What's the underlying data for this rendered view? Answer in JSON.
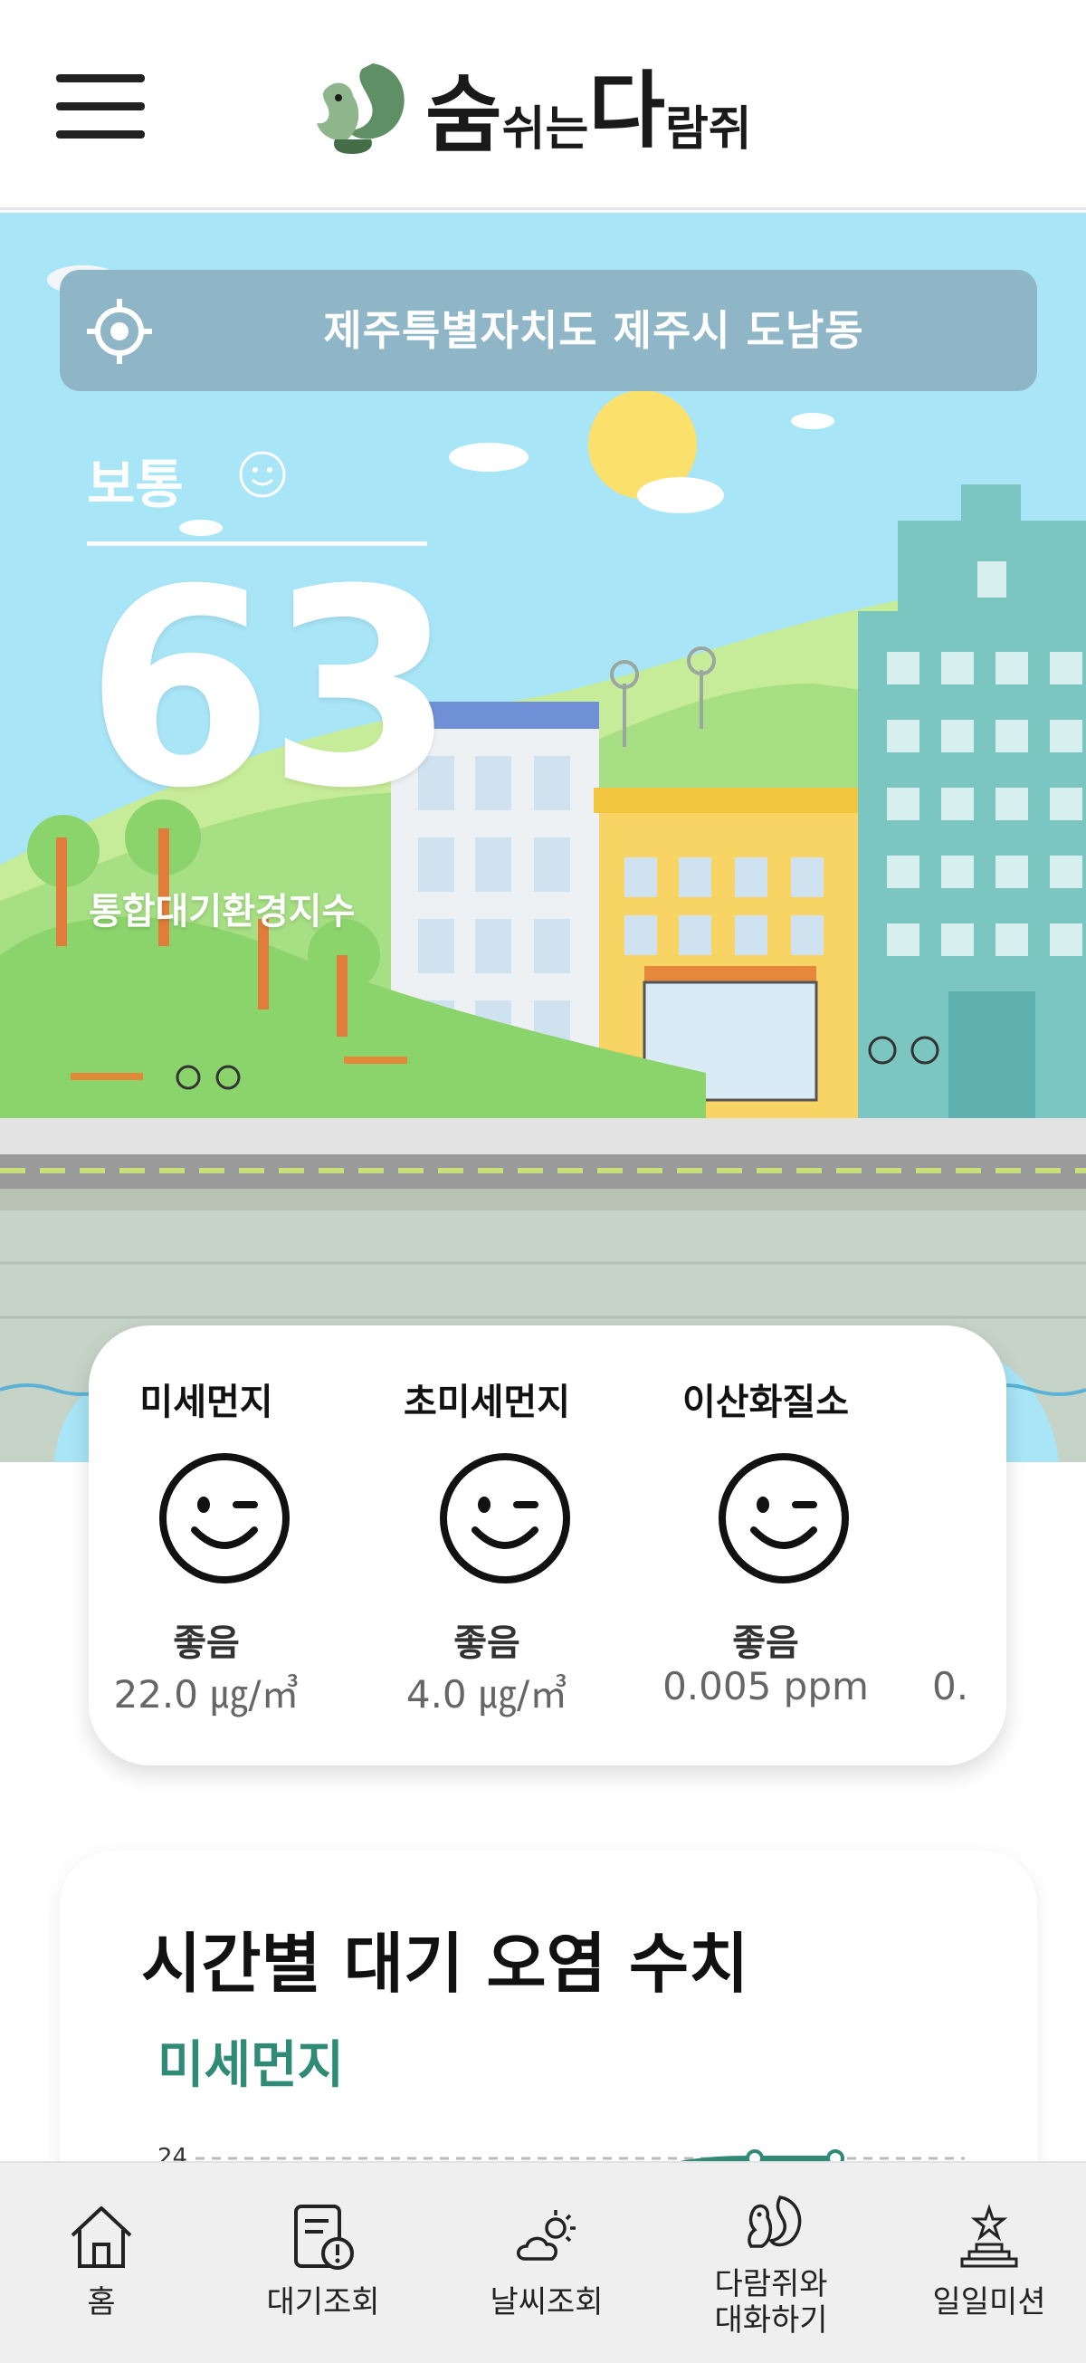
{
  "header": {
    "menu_icon": "hamburger-menu-icon",
    "logo_icon": "squirrel-icon",
    "logo_parts": [
      "숨",
      "쉬는",
      "다",
      "람쥐"
    ]
  },
  "location": {
    "icon": "gps-target-icon",
    "text": "제주특별자치도 제주시 도남동"
  },
  "air_quality": {
    "status": "보통",
    "status_icon": "smile-face-icon",
    "index_value": "63",
    "index_label": "통합대기환경지수"
  },
  "pollutants": [
    {
      "name": "미세먼지",
      "icon": "wink-face-icon",
      "grade": "좋음",
      "value": "22.0 ㎍/㎥"
    },
    {
      "name": "초미세먼지",
      "icon": "wink-face-icon",
      "grade": "좋음",
      "value": "4.0 ㎍/㎥"
    },
    {
      "name": "이산화질소",
      "icon": "wink-face-icon",
      "grade": "좋음",
      "value": "0.005 ppm"
    },
    {
      "name": "",
      "icon": "",
      "grade": "",
      "value": "0."
    }
  ],
  "hourly": {
    "title": "시간별 대기 오염 수치",
    "subtitle": "미세먼지",
    "axis_tick": "24"
  },
  "nav": [
    {
      "label": "홈",
      "icon": "home-icon"
    },
    {
      "label": "대기조회",
      "icon": "document-alert-icon"
    },
    {
      "label": "날씨조회",
      "icon": "weather-icon"
    },
    {
      "label": "다람쥐와\n대화하기",
      "icon": "squirrel-icon"
    },
    {
      "label": "일일미션",
      "icon": "trophy-icon"
    }
  ],
  "colors": {
    "sky": "#a8e5f7",
    "accent_green": "#2f8a76",
    "location_bar": "#8fb6c6",
    "nav_bg": "#efefef"
  }
}
